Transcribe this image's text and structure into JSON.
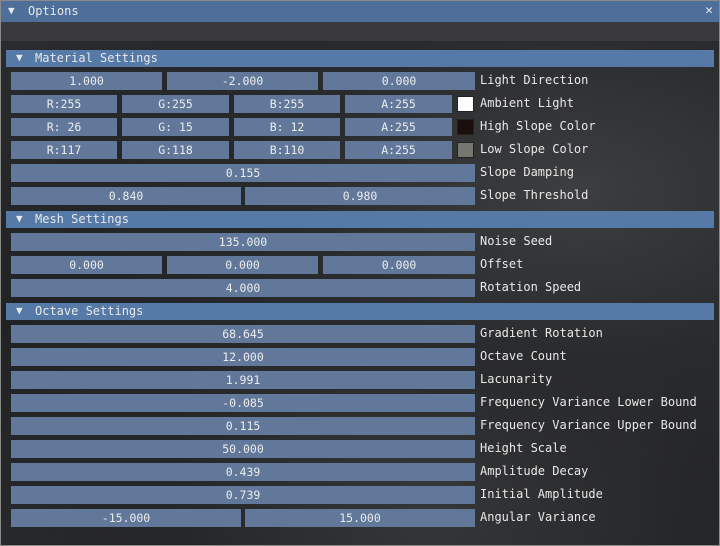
{
  "window": {
    "title": "Options",
    "close_glyph": "✕",
    "collapse_glyph": "▼"
  },
  "sections": {
    "material": "Material Settings",
    "mesh": "Mesh Settings",
    "octave": "Octave Settings"
  },
  "material": {
    "light_direction": {
      "label": "Light Direction",
      "values": [
        "1.000",
        "-2.000",
        "0.000"
      ]
    },
    "ambient_light": {
      "label": "Ambient Light",
      "values": [
        "R:255",
        "G:255",
        "B:255",
        "A:255"
      ],
      "color": "#ffffff"
    },
    "high_slope_color": {
      "label": "High Slope Color",
      "values": [
        "R: 26",
        "G: 15",
        "B: 12",
        "A:255"
      ],
      "color": "#1a0f0c"
    },
    "low_slope_color": {
      "label": "Low Slope Color",
      "values": [
        "R:117",
        "G:118",
        "B:110",
        "A:255"
      ],
      "color": "#75766e"
    },
    "slope_damping": {
      "label": "Slope Damping",
      "values": [
        "0.155"
      ]
    },
    "slope_threshold": {
      "label": "Slope Threshold",
      "values": [
        "0.840",
        "0.980"
      ]
    }
  },
  "mesh": {
    "noise_seed": {
      "label": "Noise Seed",
      "values": [
        "135.000"
      ]
    },
    "offset": {
      "label": "Offset",
      "values": [
        "0.000",
        "0.000",
        "0.000"
      ]
    },
    "rotation_speed": {
      "label": "Rotation Speed",
      "values": [
        "4.000"
      ]
    }
  },
  "octave": {
    "gradient_rotation": {
      "label": "Gradient Rotation",
      "values": [
        "68.645"
      ]
    },
    "octave_count": {
      "label": "Octave Count",
      "values": [
        "12.000"
      ]
    },
    "lacunarity": {
      "label": "Lacunarity",
      "values": [
        "1.991"
      ]
    },
    "freq_var_lower": {
      "label": "Frequency Variance Lower Bound",
      "values": [
        "-0.085"
      ]
    },
    "freq_var_upper": {
      "label": "Frequency Variance Upper Bound",
      "values": [
        "0.115"
      ]
    },
    "height_scale": {
      "label": "Height Scale",
      "values": [
        "50.000"
      ]
    },
    "amplitude_decay": {
      "label": "Amplitude Decay",
      "values": [
        "0.439"
      ]
    },
    "initial_amplitude": {
      "label": "Initial Amplitude",
      "values": [
        "0.739"
      ]
    },
    "angular_variance": {
      "label": "Angular Variance",
      "values": [
        "-15.000",
        "15.000"
      ]
    }
  },
  "colors": {
    "titlebar": "#4d6f99",
    "section_header": "#557aa8",
    "field": "#61789b"
  }
}
